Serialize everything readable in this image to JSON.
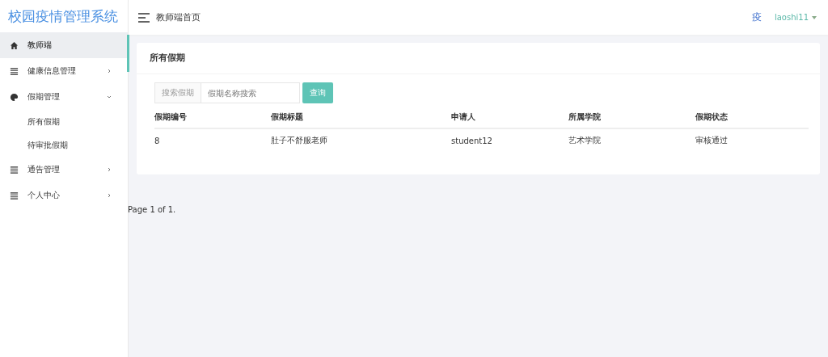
{
  "brand": "校园疫情管理系统",
  "header": {
    "title": "教师端首页",
    "avatar": "疫",
    "user": "laoshi11"
  },
  "sidebar": {
    "items": [
      {
        "label": "教师端",
        "kind": "home",
        "selected": true
      },
      {
        "label": "健康信息管理",
        "kind": "list",
        "selected": false,
        "expanded": false
      },
      {
        "label": "假期管理",
        "kind": "palette",
        "selected": false,
        "expanded": true,
        "children": [
          {
            "label": "所有假期"
          },
          {
            "label": "待审批假期"
          }
        ]
      },
      {
        "label": "通告管理",
        "kind": "list",
        "selected": false,
        "expanded": false
      },
      {
        "label": "个人中心",
        "kind": "list",
        "selected": false,
        "expanded": false
      }
    ]
  },
  "card": {
    "title": "所有假期",
    "search": {
      "label": "搜索假期",
      "placeholder": "假期名称搜索",
      "button": "查询"
    },
    "table": {
      "columns": [
        "假期编号",
        "假期标题",
        "申请人",
        "所属学院",
        "假期状态"
      ],
      "rows": [
        [
          "8",
          "肚子不舒服老师",
          "student12",
          "艺术学院",
          "审核通过"
        ]
      ]
    }
  },
  "pagination": "Page 1 of 1."
}
